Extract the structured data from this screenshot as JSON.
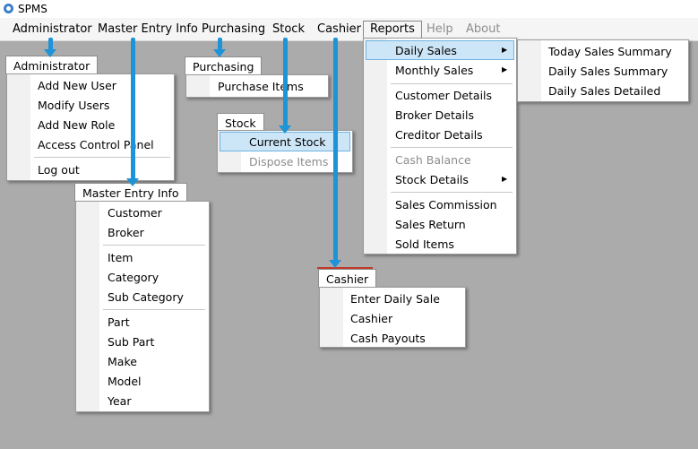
{
  "window": {
    "title": "SPMS",
    "icon": "app-icon"
  },
  "menubar": {
    "items": [
      {
        "label": "Administrator"
      },
      {
        "label": "Master Entry Info"
      },
      {
        "label": "Purchasing"
      },
      {
        "label": "Stock"
      },
      {
        "label": "Cashier"
      },
      {
        "label": "Reports"
      },
      {
        "label": "Help"
      },
      {
        "label": "About"
      }
    ]
  },
  "administrator_menu": {
    "tab": "Administrator",
    "items": [
      "Add New User",
      "Modify Users",
      "Add New Role",
      "Access Control Panel",
      "Log out"
    ]
  },
  "purchasing_menu": {
    "tab": "Purchasing",
    "items": [
      "Purchase Items"
    ]
  },
  "stock_menu": {
    "tab": "Stock",
    "items": [
      "Current Stock",
      "Dispose Items"
    ]
  },
  "master_menu": {
    "tab": "Master Entry Info",
    "items": [
      "Customer",
      "Broker",
      "Item",
      "Category",
      "Sub Category",
      "Part",
      "Sub Part",
      "Make",
      "Model",
      "Year"
    ]
  },
  "cashier_menu": {
    "tab": "Cashier",
    "items": [
      "Enter Daily Sale",
      "Cashier",
      "Cash Payouts"
    ]
  },
  "reports_menu": {
    "items": [
      "Daily Sales",
      "Monthly Sales",
      "Customer Details",
      "Broker Details",
      "Creditor Details",
      "Cash Balance",
      "Stock Details",
      "Sales Commission",
      "Sales Return",
      "Sold Items"
    ]
  },
  "daily_sales_submenu": {
    "items": [
      "Today Sales Summary",
      "Daily Sales Summary",
      "Daily Sales Detailed"
    ]
  },
  "colors": {
    "highlight": "#cde6f7",
    "annotation": "#1e93d8",
    "background": "#ababab"
  }
}
